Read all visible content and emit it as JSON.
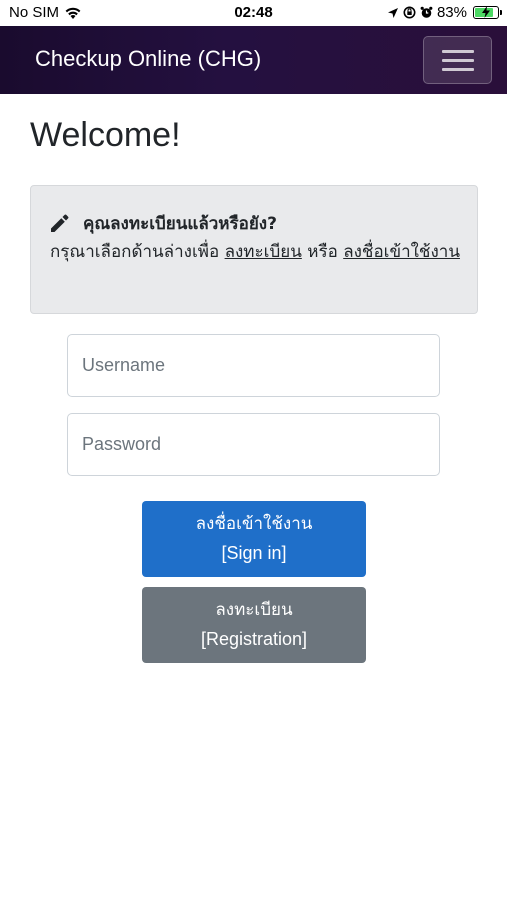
{
  "status_bar": {
    "carrier": "No SIM",
    "time": "02:48",
    "battery_percent": "83%",
    "battery_level": 0.83
  },
  "navbar": {
    "brand": "Checkup Online (CHG)",
    "menu_icon": "hamburger-icon"
  },
  "page": {
    "heading": "Welcome!"
  },
  "alert": {
    "icon": "pencil-icon",
    "title": "คุณลงทะเบียนแล้วหรือยัง?",
    "text_before": "กรุณาเลือกด้านล่างเพื่อ ",
    "register_link": "ลงทะเบียน",
    "text_or": " หรือ ",
    "signin_link": "ลงชื่อเข้าใช้งาน"
  },
  "form": {
    "username_placeholder": "Username",
    "username_value": "",
    "password_placeholder": "Password",
    "password_value": ""
  },
  "buttons": {
    "signin_th": "ลงชื่อเข้าใช้งาน",
    "signin_en": "[Sign in]",
    "register_th": "ลงทะเบียน",
    "register_en": "[Registration]"
  },
  "colors": {
    "primary": "#1f6fc9",
    "secondary": "#6c757d",
    "navbar": "#1a0b2e"
  }
}
